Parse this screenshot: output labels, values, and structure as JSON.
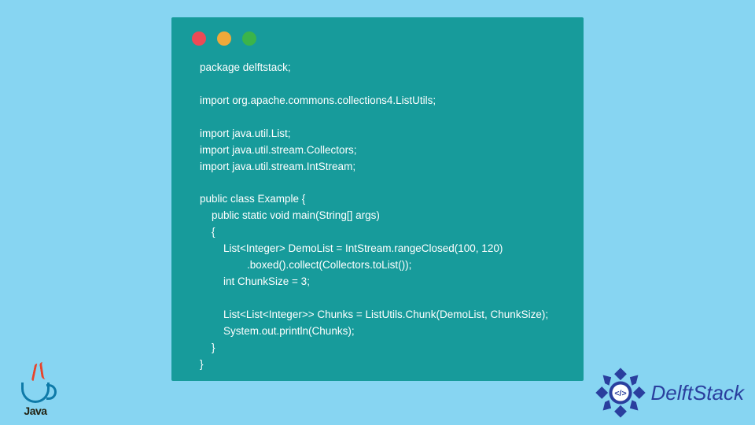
{
  "code": {
    "lines": [
      "package delftstack;",
      "",
      "import org.apache.commons.collections4.ListUtils;",
      "",
      "import java.util.List;",
      "import java.util.stream.Collectors;",
      "import java.util.stream.IntStream;",
      "",
      "public class Example {",
      "    public static void main(String[] args)",
      "    {",
      "        List<Integer> DemoList = IntStream.rangeClosed(100, 120)",
      "                .boxed().collect(Collectors.toList());",
      "        int ChunkSize = 3;",
      "",
      "        List<List<Integer>> Chunks = ListUtils.Chunk(DemoList, ChunkSize);",
      "        System.out.println(Chunks);",
      "    }",
      "}"
    ]
  },
  "logos": {
    "java_label": "Java",
    "delftstack_label": "DelftStack"
  },
  "colors": {
    "page_bg": "#87d5f2",
    "window_bg": "#179b9b",
    "code_text": "#ffffff",
    "dot_red": "#ec4a55",
    "dot_yellow": "#f0a93a",
    "dot_green": "#3bb44a",
    "delftstack_blue": "#2a3f9e",
    "java_cup": "#0e7aa8",
    "java_steam": "#e8442b"
  }
}
